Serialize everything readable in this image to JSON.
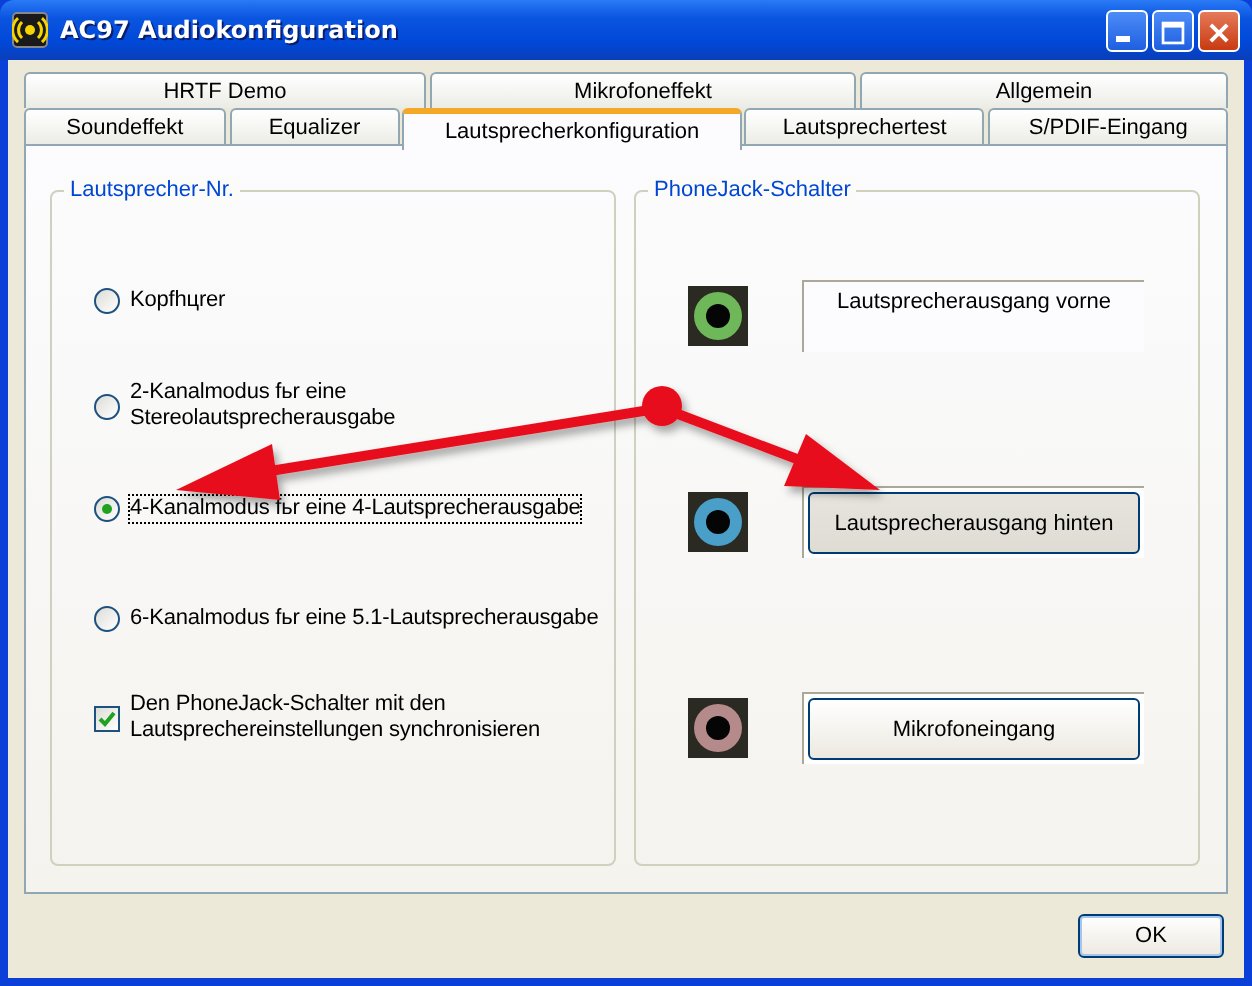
{
  "window": {
    "title": "AC97 Audiokonfiguration"
  },
  "tab_rows": [
    {
      "tabs": [
        {
          "label": "HRTF Demo",
          "selected": false
        },
        {
          "label": "Mikrofoneffekt",
          "selected": false
        },
        {
          "label": "Allgemein",
          "selected": false
        }
      ]
    },
    {
      "tabs": [
        {
          "label": "Soundeffekt",
          "selected": false
        },
        {
          "label": "Equalizer",
          "selected": false
        },
        {
          "label": "Lautsprecherkonfiguration",
          "selected": true
        },
        {
          "label": "Lautsprechertest",
          "selected": false
        },
        {
          "label": "S/PDIF-Eingang",
          "selected": false
        }
      ]
    }
  ],
  "speaker_group": {
    "title": "Lautsprecher-Nr.",
    "options": [
      {
        "label": "Kopfhцrer",
        "selected": false
      },
      {
        "label": "2-Kanalmodus fьr eine Stereolautsprecherausgabe",
        "selected": false
      },
      {
        "label": "4-Kanalmodus fьr eine 4-Lautsprecherausgabe",
        "selected": true
      },
      {
        "label": "6-Kanalmodus fьr eine 5.1-Lautsprecherausgabe",
        "selected": false
      }
    ],
    "sync_checkbox": {
      "label": "Den PhoneJack-Schalter mit den Lautsprechereinstellungen synchronisieren",
      "checked": true
    }
  },
  "jack_group": {
    "title": "PhoneJack-Schalter",
    "jacks": [
      {
        "kind": "label",
        "color": "#6fb85a",
        "label": "Lautsprecherausgang vorne",
        "selected": false
      },
      {
        "kind": "button",
        "color": "#4a9fc8",
        "label": "Lautsprecherausgang hinten",
        "selected": true
      },
      {
        "kind": "button",
        "color": "#b58a8a",
        "label": "Mikrofoneingang",
        "selected": false
      }
    ]
  },
  "buttons": [
    "OK"
  ]
}
